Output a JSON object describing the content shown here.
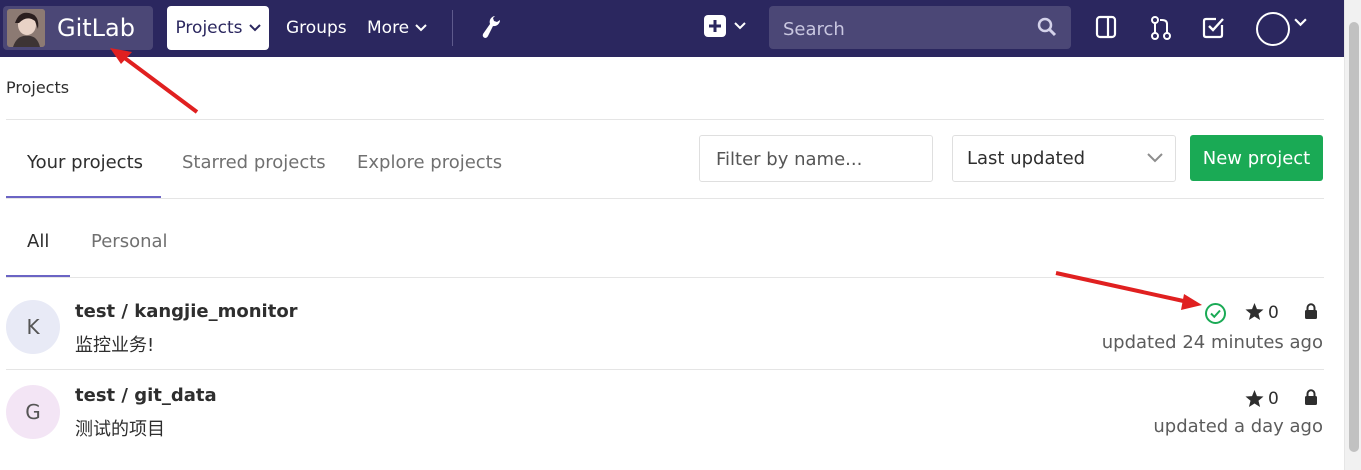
{
  "nav": {
    "brand": "GitLab",
    "projects": "Projects",
    "groups": "Groups",
    "more": "More",
    "search_placeholder": "Search"
  },
  "breadcrumb": "Projects",
  "tabs": [
    "Your projects",
    "Starred projects",
    "Explore projects"
  ],
  "filter_placeholder": "Filter by name...",
  "sort": "Last updated",
  "new_project": "New project",
  "subtabs": [
    "All",
    "Personal"
  ],
  "projects": [
    {
      "initial": "K",
      "title": "test / kangjie_monitor",
      "description": "监控业务!",
      "stars": "0",
      "updated": "updated 24 minutes ago",
      "pipeline_status": "passed",
      "visibility": "private"
    },
    {
      "initial": "G",
      "title": "test / git_data",
      "description": "测试的项目",
      "stars": "0",
      "updated": "updated a day ago",
      "visibility": "private"
    }
  ],
  "colors": {
    "nav_bg": "#2b275f",
    "new_project_green": "#1aaa55",
    "annotation_red": "#e02020",
    "active_tab_underline": "#6b64c4"
  }
}
